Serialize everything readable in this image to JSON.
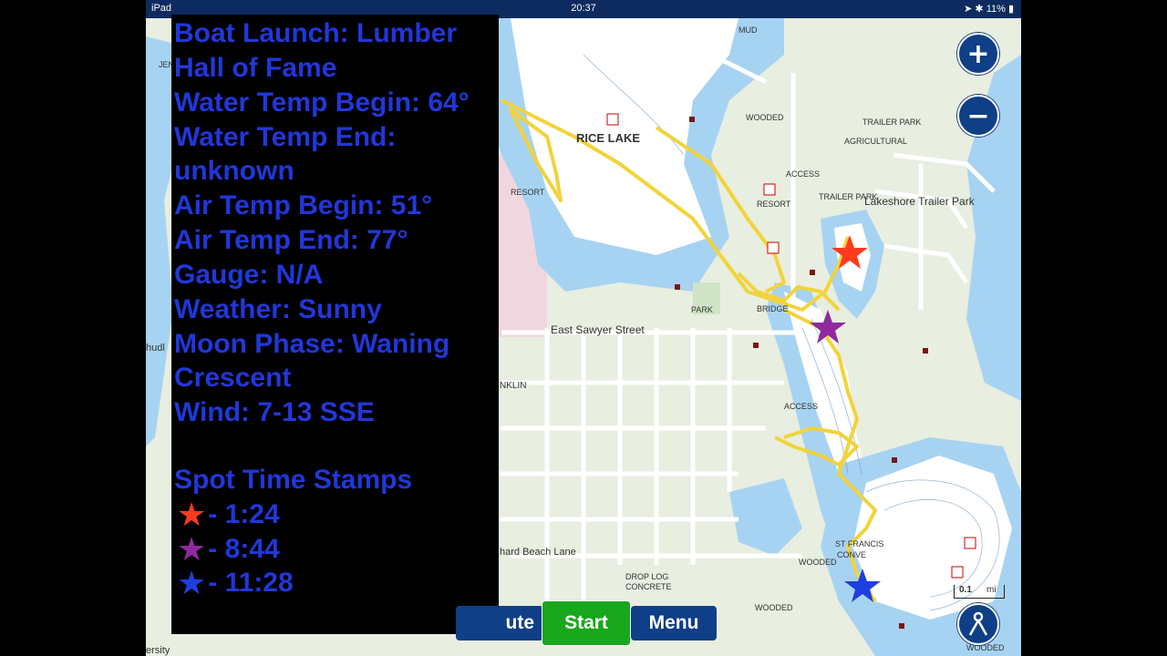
{
  "status_bar": {
    "device": "iPad",
    "time": "20:37",
    "battery": "11%"
  },
  "info_panel": {
    "lines": [
      "Boat Launch: Lumber",
      "Hall of Fame",
      "Water Temp Begin: 64°",
      "Water Temp End:",
      "unknown",
      "Air Temp Begin: 51°",
      "Air Temp End: 77°",
      "Gauge: N/A",
      "Weather: Sunny",
      "Moon Phase: Waning",
      "Crescent",
      "Wind: 7-13 SSE"
    ],
    "spot_heading": "Spot Time Stamps",
    "spots": [
      {
        "time": "- 1:24",
        "color": "#ff3b1f"
      },
      {
        "time": "- 8:44",
        "color": "#8e2a9e"
      },
      {
        "time": "- 11:28",
        "color": "#1d3fe0"
      }
    ]
  },
  "map": {
    "labels": {
      "rice_lake": "RICE LAKE",
      "mud": "MUD",
      "wooded_1": "WOODED",
      "trailer_park_1": "TRAILER PARK",
      "agricultural": "AGRICULTURAL",
      "access_1": "ACCESS",
      "resort_1": "RESORT",
      "trailer_park_2": "TRAILER PARK",
      "lakeshore": "Lakeshore Trailer Park",
      "resort_2": "RESORT",
      "park": "PARK",
      "bridge": "BRIDGE",
      "east_sawyer": "East Sawyer Street",
      "nklin": "NKLIN",
      "access_2": "ACCESS",
      "beach_lane": "hard Beach Lane",
      "st_francis": "ST FRANCIS",
      "conve": "CONVE",
      "wooded_2": "WOODED",
      "drop_log": "DROP LOG",
      "concrete": "CONCRETE",
      "wooded_3": "WOODED",
      "wooded_4": "WOODED",
      "scale": "0.1",
      "scale_unit": "mi",
      "jen": "JEN",
      "hudl": "hudl",
      "ersity": "ersity"
    }
  },
  "controls": {
    "zoom_in": "+",
    "zoom_out": "−",
    "route_label": "ute",
    "start_label": "Start",
    "menu_label": "Menu"
  },
  "colors": {
    "water": "#a7d3f2",
    "land": "#e8eee0",
    "track": "#f2d33a",
    "panel_text": "#2137d9",
    "start_green": "#18a71d",
    "nav_blue": "#0f3f86"
  }
}
